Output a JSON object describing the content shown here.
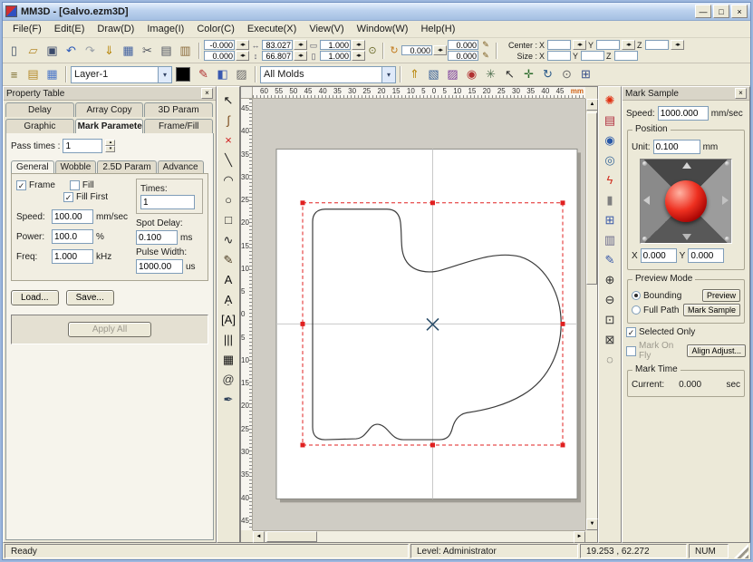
{
  "window": {
    "title": "MM3D - [Galvo.ezm3D]",
    "minimize": "—",
    "restore": "□",
    "close": "×"
  },
  "menu": {
    "items": [
      "File(F)",
      "Edit(E)",
      "Draw(D)",
      "Image(I)",
      "Color(C)",
      "Execute(X)",
      "View(V)",
      "Window(W)",
      "Help(H)"
    ]
  },
  "glyphs": {
    "up": "▴",
    "down": "▾",
    "lr": "◂▸",
    "dropdown": "▾",
    "scroll_up": "▲",
    "scroll_down": "▼",
    "scroll_left": "◄",
    "scroll_right": "►"
  },
  "colors": {
    "selection_box": "#e02020",
    "shape_outline": "#3c3c3c",
    "crosshair": "#c8c8c8",
    "joystick_button": "#cc1f1f",
    "pen_color": "#000000"
  },
  "toolbar1": {
    "icons": [
      {
        "name": "new-icon",
        "glyph": "▯",
        "color": "#44546a"
      },
      {
        "name": "open-icon",
        "glyph": "▱",
        "color": "#b58a2a"
      },
      {
        "name": "save-icon",
        "glyph": "▣",
        "color": "#3a4a6b"
      },
      {
        "name": "undo-icon",
        "glyph": "↶",
        "color": "#2857b8"
      },
      {
        "name": "redo-icon",
        "glyph": "↷",
        "color": "#9aa0a8"
      },
      {
        "name": "import-entity-icon",
        "glyph": "⇓",
        "color": "#b8860b"
      },
      {
        "name": "hatch-manager-icon",
        "glyph": "▦",
        "color": "#4060a0"
      },
      {
        "name": "cut-icon",
        "glyph": "✂",
        "color": "#50555f"
      },
      {
        "name": "copy-icon",
        "glyph": "▤",
        "color": "#50555f"
      },
      {
        "name": "paste-icon",
        "glyph": "▥",
        "color": "#8a6a3a"
      }
    ],
    "pos_x": "-0.000",
    "pos_y": "0.000",
    "size_w": "83.027",
    "size_h": "66.807",
    "scale_x": "1.000",
    "scale_y": "1.000",
    "angle": "0.000",
    "offset_x": "0.000",
    "offset_y": "0.000",
    "center_label": "Center :",
    "size_label": "Size :",
    "axis_x": "X",
    "axis_y": "Y",
    "axis_z": "Z",
    "center_x": "",
    "center_y": "",
    "center_z": "",
    "size_x": "",
    "size_y": "",
    "size_z": ""
  },
  "toolbar2": {
    "left_icons": [
      {
        "name": "entity-list-icon",
        "glyph": "≡",
        "color": "#7a6a2a"
      },
      {
        "name": "new-layer-icon",
        "glyph": "▤",
        "color": "#b58a2a"
      },
      {
        "name": "layer-properties-icon",
        "glyph": "▦",
        "color": "#4a76c8"
      }
    ],
    "layer_select": "Layer-1",
    "pen_color": "#000000",
    "mid_icons": [
      {
        "name": "pen-color-icon",
        "glyph": "✎",
        "color": "#b03030"
      },
      {
        "name": "fill-style-icon",
        "glyph": "◧",
        "color": "#3858b0"
      },
      {
        "name": "hatch-style-icon",
        "glyph": "▨",
        "color": "#6a6a6a"
      }
    ],
    "mold_select": "All Molds",
    "right_icons": [
      {
        "name": "mold-export-icon",
        "glyph": "⇑",
        "color": "#b8860b"
      },
      {
        "name": "mold-manager-icon",
        "glyph": "▧",
        "color": "#386098"
      },
      {
        "name": "fill-parameter-icon",
        "glyph": "▨",
        "color": "#7a3a9a"
      },
      {
        "name": "mark-preview-icon",
        "glyph": "◉",
        "color": "#b03030"
      },
      {
        "name": "settings-icon",
        "glyph": "✳",
        "color": "#507050"
      },
      {
        "name": "pick-tool-icon",
        "glyph": "↖",
        "color": "#303030"
      },
      {
        "name": "move-tool-icon",
        "glyph": "✛",
        "color": "#2a6a2a"
      },
      {
        "name": "rotate-tool-icon",
        "glyph": "↻",
        "color": "#2a5a8a"
      },
      {
        "name": "lock-icon",
        "glyph": "⊙",
        "color": "#6a6a6a"
      },
      {
        "name": "align-tools-icon",
        "glyph": "⊞",
        "color": "#38508a"
      }
    ]
  },
  "left_tools": [
    {
      "name": "select-tool-icon",
      "glyph": "↖",
      "color": "#101010"
    },
    {
      "name": "node-edit-tool-icon",
      "glyph": "∫",
      "color": "#7a4a1a"
    },
    {
      "name": "delete-tool-icon",
      "glyph": "×",
      "color": "#d02020"
    },
    {
      "name": "line-tool-icon",
      "glyph": "╲",
      "color": "#202020"
    },
    {
      "name": "arc-tool-icon",
      "glyph": "◠",
      "color": "#202020"
    },
    {
      "name": "ellipse-tool-icon",
      "glyph": "○",
      "color": "#202020"
    },
    {
      "name": "rectangle-tool-icon",
      "glyph": "□",
      "color": "#202020"
    },
    {
      "name": "curve-tool-icon",
      "glyph": "∿",
      "color": "#202020"
    },
    {
      "name": "pen-tool-icon",
      "glyph": "✎",
      "color": "#4a3a20"
    },
    {
      "name": "text-tool-icon",
      "glyph": "A",
      "color": "#101010"
    },
    {
      "name": "text-cursor-tool-icon",
      "glyph": "Ạ",
      "color": "#101010"
    },
    {
      "name": "boxed-text-tool-icon",
      "glyph": "[A]",
      "color": "#101010"
    },
    {
      "name": "barcode-tool-icon",
      "glyph": "|||",
      "color": "#101010"
    },
    {
      "name": "matrix-code-tool-icon",
      "glyph": "▦",
      "color": "#101010"
    },
    {
      "name": "spiral-tool-icon",
      "glyph": "@",
      "color": "#3a3a3a"
    },
    {
      "name": "stylus-tool-icon",
      "glyph": "✒",
      "color": "#30425a"
    }
  ],
  "right_tools": [
    {
      "name": "red-light-icon",
      "glyph": "✺",
      "color": "#e03010"
    },
    {
      "name": "mark-parameter-icon",
      "glyph": "▤",
      "color": "#b03040"
    },
    {
      "name": "preview-window-icon",
      "glyph": "◉",
      "color": "#2858a8"
    },
    {
      "name": "view-eye-icon",
      "glyph": "◎",
      "color": "#38689a"
    },
    {
      "name": "quick-mark-icon",
      "glyph": "ϟ",
      "color": "#d03020"
    },
    {
      "name": "stop-icon",
      "glyph": "▮",
      "color": "#808080"
    },
    {
      "name": "grid-icon",
      "glyph": "⊞",
      "color": "#3858a8"
    },
    {
      "name": "clipboard-icon",
      "glyph": "▥",
      "color": "#6a6a8a"
    },
    {
      "name": "draw-order-icon",
      "glyph": "✎",
      "color": "#3858a8"
    },
    {
      "name": "zoom-in-icon",
      "glyph": "⊕",
      "color": "#303030"
    },
    {
      "name": "zoom-out-icon",
      "glyph": "⊖",
      "color": "#303030"
    },
    {
      "name": "zoom-window-icon",
      "glyph": "⊡",
      "color": "#303030"
    },
    {
      "name": "zoom-extents-icon",
      "glyph": "⊠",
      "color": "#303030"
    },
    {
      "name": "zoom-selected-icon",
      "glyph": "◌",
      "color": "#303030"
    }
  ],
  "rulers": {
    "top": [
      "60",
      "55",
      "50",
      "45",
      "40",
      "35",
      "30",
      "25",
      "20",
      "15",
      "10",
      "5",
      "0",
      "5",
      "10",
      "15",
      "20",
      "25",
      "30",
      "35",
      "40",
      "45"
    ],
    "unit": "mm",
    "left": [
      "45",
      "40",
      "35",
      "30",
      "25",
      "20",
      "15",
      "10",
      "5",
      "0",
      "5",
      "10",
      "15",
      "20",
      "25",
      "30",
      "35",
      "40",
      "45"
    ]
  },
  "property_panel": {
    "title": "Property Table",
    "close": "×",
    "tabs_row1": [
      {
        "label": "Delay",
        "name": "tab-delay"
      },
      {
        "label": "Array Copy",
        "name": "tab-array-copy"
      },
      {
        "label": "3D Param",
        "name": "tab-3d-param"
      }
    ],
    "tabs_row2": [
      {
        "label": "Graphic",
        "name": "tab-graphic"
      },
      {
        "label": "Mark Parameter",
        "name": "tab-mark-parameter",
        "class": "active"
      },
      {
        "label": "Frame/Fill",
        "name": "tab-frame-fill"
      }
    ],
    "pass_times_label": "Pass times :",
    "pass_times": "1",
    "sub_tabs": [
      {
        "label": "General",
        "name": "subtab-general",
        "class": "active"
      },
      {
        "label": "Wobble",
        "name": "subtab-wobble"
      },
      {
        "label": "2.5D Param",
        "name": "subtab-25d-param"
      },
      {
        "label": "Advance",
        "name": "subtab-advance"
      }
    ],
    "frame_label": "Frame",
    "frame_check": "✓",
    "fill_label": "Fill",
    "fill_check": "",
    "fill_first_label": "Fill First",
    "fill_first_check": "✓",
    "speed_label": "Speed:",
    "speed": "100.00",
    "speed_unit": "mm/sec",
    "power_label": "Power:",
    "power": "100.0",
    "power_unit": "%",
    "freq_label": "Freq:",
    "freq": "1.000",
    "freq_unit": "kHz",
    "times_label": "Times:",
    "times": "1",
    "spot_delay_label": "Spot Delay:",
    "spot_delay": "0.100",
    "spot_delay_unit": "ms",
    "pulse_width_label": "Pulse Width:",
    "pulse_width": "1000.00",
    "pulse_width_unit": "us",
    "load_button": "Load...",
    "save_button": "Save...",
    "apply_button": "Apply All"
  },
  "mark_panel": {
    "title": "Mark Sample",
    "close": "×",
    "speed_label": "Speed:",
    "speed": "1000.000",
    "speed_unit": "mm/sec",
    "position_label": "Position",
    "unit_label": "Unit:",
    "unit": "0.100",
    "unit_unit": "mm",
    "x_label": "X",
    "x": "0.000",
    "y_label": "Y",
    "y": "0.000",
    "preview_mode_label": "Preview Mode",
    "bounding_label": "Bounding",
    "full_path_label": "Full Path",
    "preview_button": "Preview",
    "mark_sample_button": "Mark Sample",
    "selected_only_label": "Selected Only",
    "selected_only_check": "✓",
    "mark_on_fly_label": "Mark On Fly",
    "mark_on_fly_check": "",
    "align_button": "Align Adjust...",
    "mark_time_label": "Mark Time",
    "current_label": "Current:",
    "current": "0.000",
    "current_unit": "sec"
  },
  "status": {
    "ready": "Ready",
    "level": "Level: Administrator",
    "coords": "19.253 , 62.272",
    "num": "NUM"
  }
}
